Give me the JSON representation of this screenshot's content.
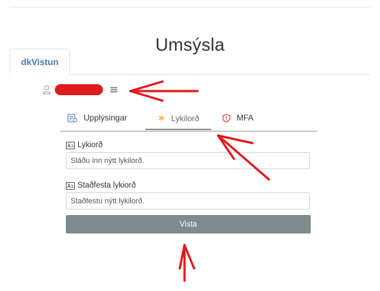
{
  "page": {
    "title": "Umsýsla"
  },
  "top_tabs": [
    {
      "label": "dkVistun",
      "active": true
    }
  ],
  "user": {
    "name_hidden": true,
    "icon": "user-icon",
    "menu_icon": "hamburger-icon"
  },
  "sub_tabs": [
    {
      "label": "Upplýsingar",
      "icon": "info-card-icon",
      "active": false
    },
    {
      "label": "Lykilorð",
      "icon": "asterisk-icon",
      "active": true
    },
    {
      "label": "MFA",
      "icon": "shield-icon",
      "active": false
    }
  ],
  "form": {
    "password": {
      "label": "Lykiorð",
      "placeholder": "Sláðu inn nýtt lykilorð.",
      "value": ""
    },
    "confirm": {
      "label": "Staðfesta lykiorð",
      "placeholder": "Staðfestu nýtt lykilorð.",
      "value": ""
    },
    "submit_label": "Vista"
  },
  "colors": {
    "accent": "#4a78b8",
    "annotation_red": "#e01a1a",
    "button_bg": "#7e8a8b",
    "asterisk": "#f0b429",
    "shield": "#d33a3a"
  }
}
